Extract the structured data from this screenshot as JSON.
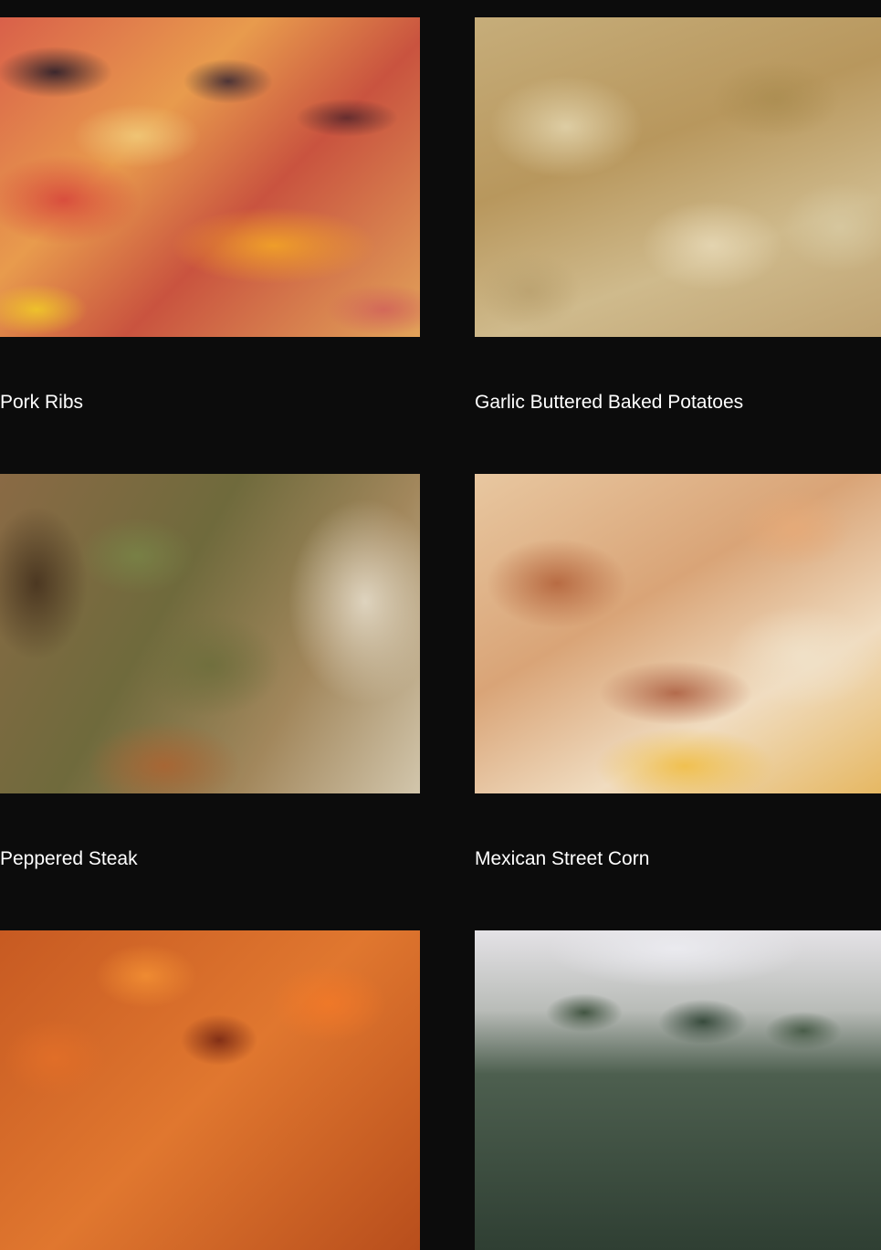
{
  "menu": {
    "items": [
      {
        "title": "Pork Ribs",
        "image": "pork-ribs-photo"
      },
      {
        "title": "Garlic Buttered Baked Potatoes",
        "image": "garlic-potatoes-photo"
      },
      {
        "title": "Peppered Steak",
        "image": "peppered-steak-photo"
      },
      {
        "title": "Mexican Street Corn",
        "image": "street-corn-photo"
      },
      {
        "title": "",
        "image": "candied-yams-photo"
      },
      {
        "title": "",
        "image": "collard-greens-photo"
      }
    ]
  },
  "colors": {
    "background": "#0c0c0c",
    "text": "#ffffff"
  }
}
